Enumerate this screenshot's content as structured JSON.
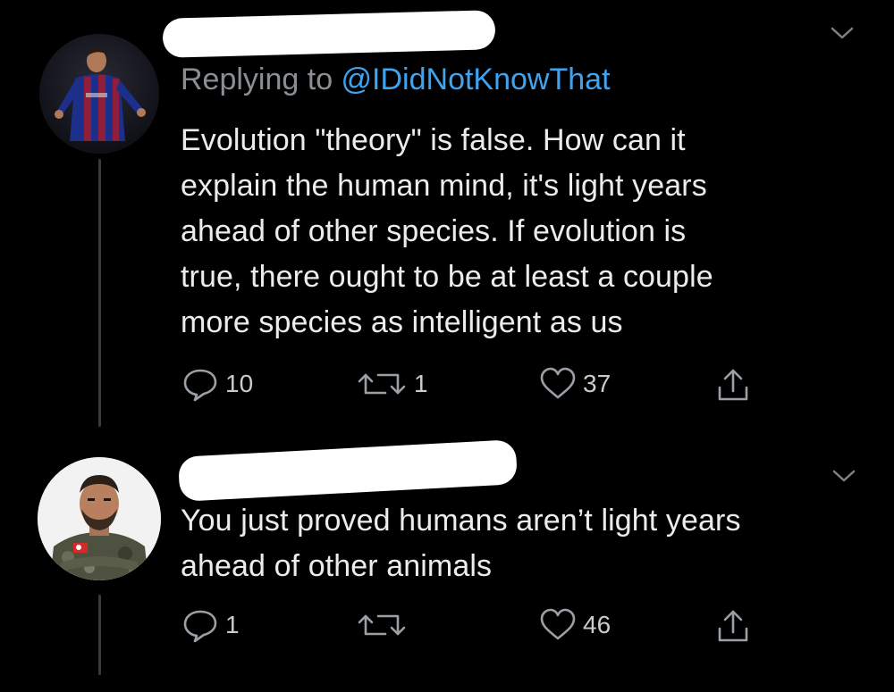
{
  "tweet1": {
    "replying_prefix": "Replying to ",
    "replying_handle": "@IDidNotKnowThat",
    "text": "Evolution \"theory\" is false. How can it\nexplain the human mind, it's light years\nahead of other species. If evolution is\ntrue, there ought to be at least a couple\nmore species as intelligent as us",
    "replies": "10",
    "retweets": "1",
    "likes": "37"
  },
  "tweet2": {
    "text": "You just proved humans aren’t light years\nahead of other animals",
    "replies": "1",
    "retweets": "",
    "likes": "46"
  },
  "colors": {
    "background": "#000000",
    "handle": "#3fa3f0",
    "secondary_text": "#8a8f94",
    "icon": "#9aa0a5",
    "redaction": "#ffffff"
  },
  "icons": [
    "chevron-down-icon",
    "reply-icon",
    "retweet-icon",
    "like-icon",
    "share-icon"
  ]
}
